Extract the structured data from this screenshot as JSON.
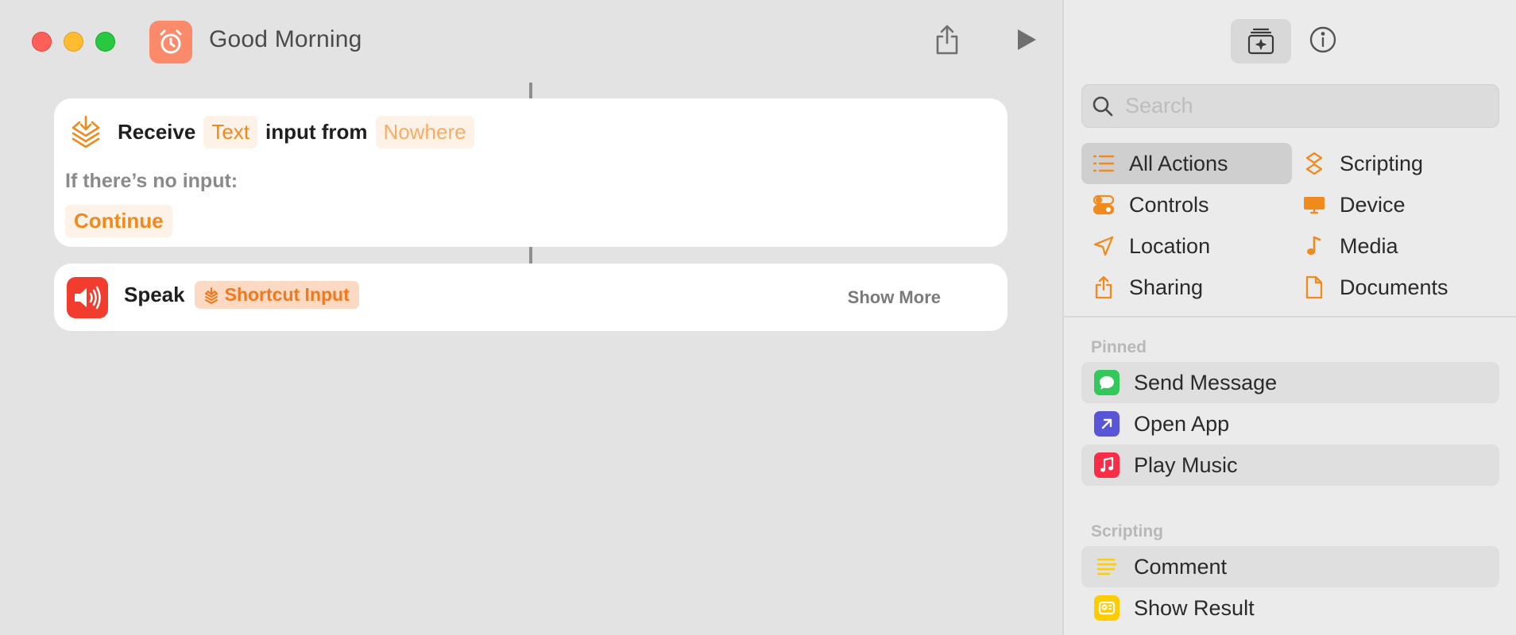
{
  "window": {
    "title": "Good Morning"
  },
  "toolbar": {
    "share_icon": "share-icon",
    "run_icon": "play-icon"
  },
  "actions": {
    "receive": {
      "verb": "Receive",
      "type_value": "Text",
      "middle_text": "input from",
      "source_value": "Nowhere",
      "no_input_label": "If there’s no input:",
      "no_input_value": "Continue"
    },
    "speak": {
      "verb": "Speak",
      "input_value": "Shortcut Input",
      "show_more": "Show More"
    }
  },
  "sidebar": {
    "search_placeholder": "Search",
    "categories": [
      {
        "label": "All Actions",
        "icon": "list-icon",
        "active": true
      },
      {
        "label": "Scripting",
        "icon": "scripting-icon"
      },
      {
        "label": "Controls",
        "icon": "toggles-icon"
      },
      {
        "label": "Device",
        "icon": "display-icon"
      },
      {
        "label": "Location",
        "icon": "location-arrow-icon"
      },
      {
        "label": "Media",
        "icon": "music-note-icon"
      },
      {
        "label": "Sharing",
        "icon": "share-icon"
      },
      {
        "label": "Documents",
        "icon": "document-icon"
      }
    ],
    "pinned_label": "Pinned",
    "pinned": [
      {
        "label": "Send Message",
        "icon": "messages-icon",
        "color": "#34c759"
      },
      {
        "label": "Open App",
        "icon": "open-app-icon",
        "color": "#5856d6"
      },
      {
        "label": "Play Music",
        "icon": "music-icon",
        "color": "#fa2d48"
      }
    ],
    "scripting_label": "Scripting",
    "scripting": [
      {
        "label": "Comment",
        "icon": "comment-icon",
        "color": "#ffcc00"
      },
      {
        "label": "Show Result",
        "icon": "show-result-icon",
        "color": "#ffcc00"
      }
    ]
  },
  "colors": {
    "accent": "#f18a1d",
    "app_icon": "#fa8a69",
    "speak_icon": "#f23c2e"
  }
}
